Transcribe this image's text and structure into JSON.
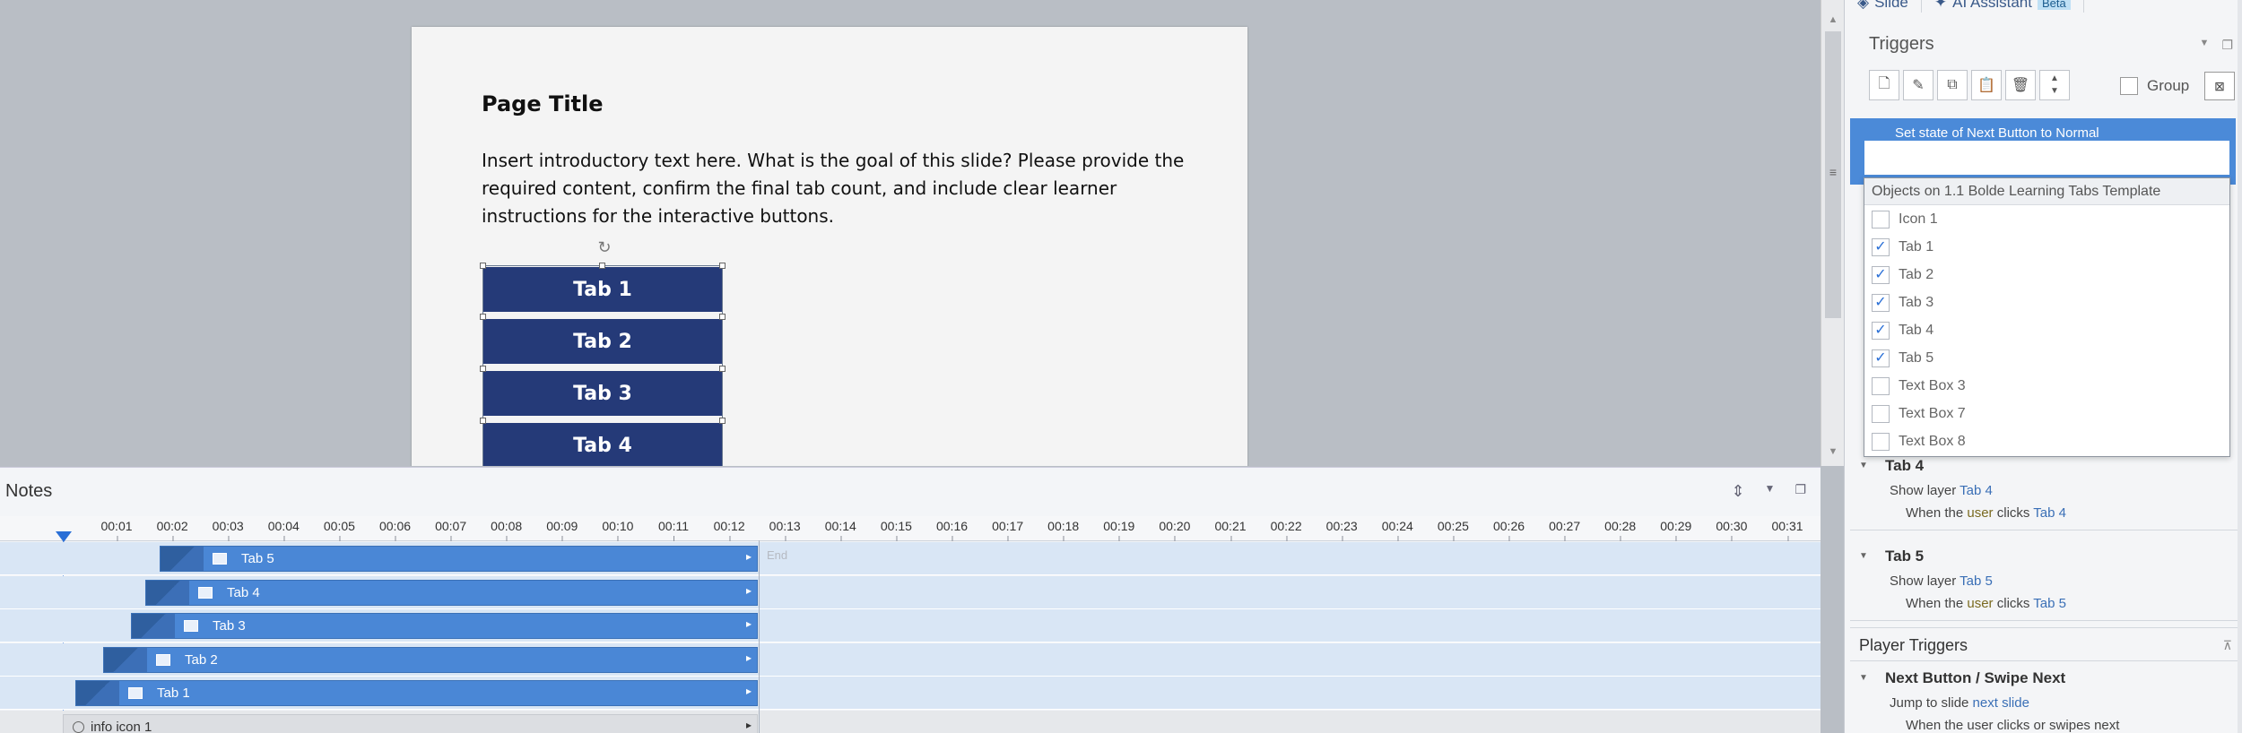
{
  "slide": {
    "title": "Page Title",
    "intro": "Insert introductory text here. What is the goal of this slide? Please provide the required content, confirm the final tab count, and include clear learner instructions for the interactive buttons.",
    "tabs": [
      "Tab 1",
      "Tab 2",
      "Tab 3",
      "Tab 4"
    ]
  },
  "notes": {
    "title": "Notes",
    "ticks": [
      "00:01",
      "00:02",
      "00:03",
      "00:04",
      "00:05",
      "00:06",
      "00:07",
      "00:08",
      "00:09",
      "00:10",
      "00:11",
      "00:12",
      "00:13",
      "00:14",
      "00:15",
      "00:16",
      "00:17",
      "00:18",
      "00:19",
      "00:20",
      "00:21",
      "00:22",
      "00:23",
      "00:24",
      "00:25",
      "00:26",
      "00:27",
      "00:28",
      "00:29",
      "00:30",
      "00:31"
    ],
    "end_label": "End",
    "tracks": [
      {
        "label": "Tab 5"
      },
      {
        "label": "Tab 4"
      },
      {
        "label": "Tab 3"
      },
      {
        "label": "Tab 2"
      },
      {
        "label": "Tab 1"
      },
      {
        "label": "info icon 1"
      }
    ]
  },
  "panel": {
    "tabs": [
      {
        "label": "Slide"
      },
      {
        "label": "AI Assistant",
        "badge": "Beta"
      }
    ],
    "triggers_title": "Triggers",
    "group_label": "Group",
    "selected_trigger": {
      "prefix": "Set state of ",
      "object": "Next Button",
      "mid": " to ",
      "state": "Normal"
    },
    "dropdown": {
      "header": "Objects on 1.1 Bolde Learning Tabs Template",
      "items": [
        {
          "label": "Icon 1",
          "checked": false
        },
        {
          "label": "Tab 1",
          "checked": true
        },
        {
          "label": "Tab 2",
          "checked": true
        },
        {
          "label": "Tab 3",
          "checked": true
        },
        {
          "label": "Tab 4",
          "checked": true
        },
        {
          "label": "Tab 5",
          "checked": true
        },
        {
          "label": "Text Box 3",
          "checked": false
        },
        {
          "label": "Text Box 7",
          "checked": false
        },
        {
          "label": "Text Box 8",
          "checked": false
        }
      ]
    },
    "sections": [
      {
        "head": "Tab 4",
        "action": "Show layer ",
        "action_target": "Tab 4",
        "when": "When the ",
        "who": "user",
        "verb": " clicks ",
        "cond_target": "Tab 4"
      },
      {
        "head": "Tab 5",
        "action": "Show layer ",
        "action_target": "Tab 5",
        "when": "When the ",
        "who": "user",
        "verb": " clicks ",
        "cond_target": "Tab 5"
      }
    ],
    "player_triggers": "Player Triggers",
    "next_section": {
      "head": "Next Button / Swipe Next",
      "action": "Jump to slide ",
      "action_target": "next slide",
      "partial": "When the user clicks or swipes next"
    }
  }
}
